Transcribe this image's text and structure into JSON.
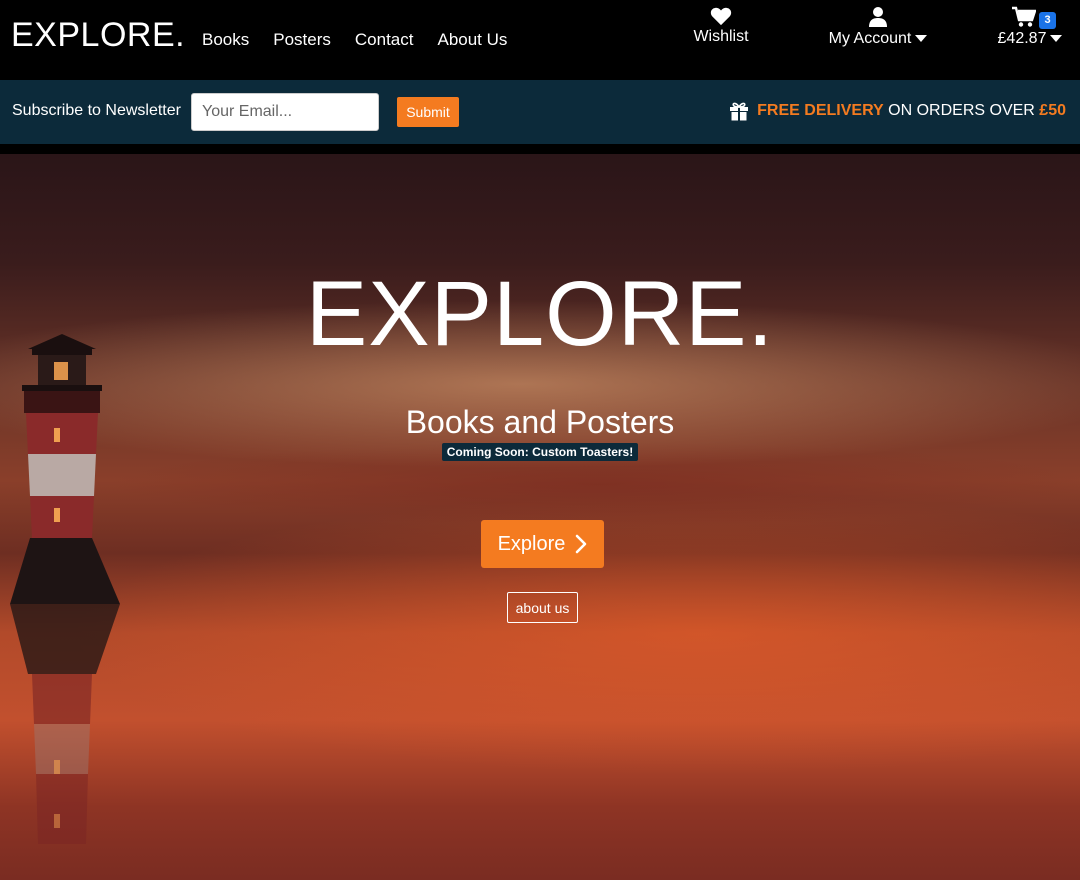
{
  "header": {
    "logo": "EXPLORE.",
    "nav": [
      "Books",
      "Posters",
      "Contact",
      "About Us"
    ],
    "wishlist_label": "Wishlist",
    "account_label": "My Account",
    "cart_total": "£42.87",
    "cart_count": "3"
  },
  "newsletter": {
    "label": "Subscribe to Newsletter",
    "placeholder": "Your Email...",
    "submit_label": "Submit"
  },
  "delivery": {
    "highlight": "FREE DELIVERY",
    "text": "ON ORDERS OVER",
    "amount": "£50"
  },
  "hero": {
    "title": "EXPLORE.",
    "subtitle": "Books and Posters",
    "coming_soon": "Coming Soon: Custom Toasters!",
    "explore_label": "Explore",
    "about_label": "about us"
  },
  "colors": {
    "accent": "#f47b20",
    "bar": "#0c2a3a",
    "badge": "#1a73e8"
  }
}
